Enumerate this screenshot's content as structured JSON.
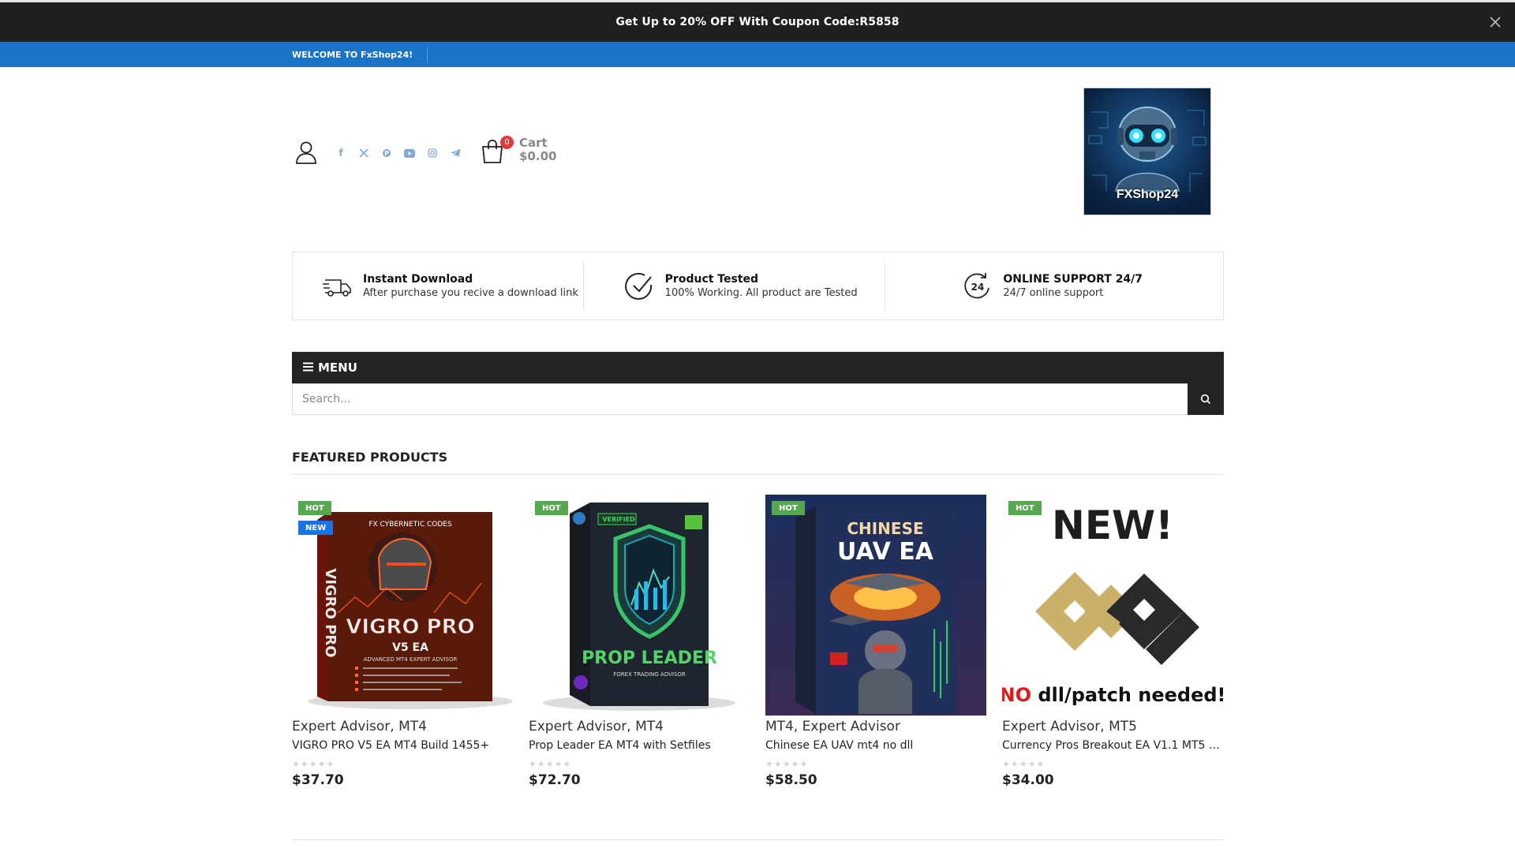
{
  "promo": {
    "prefix": "Get Up to ",
    "discount": "20% OFF",
    "middle": " With Coupon Code:",
    "code": "R5858"
  },
  "welcome": {
    "text": "WELCOME TO FxShop24!"
  },
  "social_icons": [
    "facebook-icon",
    "x-twitter-icon",
    "pinterest-icon",
    "youtube-icon",
    "instagram-icon",
    "telegram-icon"
  ],
  "cart": {
    "count": "0",
    "label": "Cart",
    "total": "$0.00"
  },
  "logo": {
    "text": "FXShop24"
  },
  "features": [
    {
      "icon": "truck-icon",
      "title": "Instant Download",
      "subtitle": "After purchase you recive a download link"
    },
    {
      "icon": "check-circle-icon",
      "title": "Product Tested",
      "subtitle": "100% Working. All product are Tested"
    },
    {
      "icon": "support-24-icon",
      "title": "ONLINE SUPPORT 24/7",
      "subtitle": "24/7 online support",
      "icon_text": "24"
    }
  ],
  "menu": {
    "label": "MENU"
  },
  "search": {
    "placeholder": "Search..."
  },
  "section": {
    "title": "FEATURED PRODUCTS"
  },
  "products": [
    {
      "badges": [
        "HOT",
        "NEW"
      ],
      "category": "Expert Advisor, MT4",
      "name": "VIGRO PRO V5 EA MT4 Build 1455+",
      "price": "$37.70",
      "rating": 0,
      "image": {
        "title": "VIGRO PRO",
        "subtitle": "V5 EA",
        "spine": "VIGRO PRO",
        "top": "FX CYBERNETIC CODES",
        "tagline": "ADVANCED MT4 EXPERT ADVISOR"
      }
    },
    {
      "badges": [
        "HOT"
      ],
      "category": "Expert Advisor, MT4",
      "name": "Prop Leader EA MT4 with Setfiles",
      "price": "$72.70",
      "rating": 0,
      "image": {
        "title": "PROP LEADER",
        "subtitle": "FOREX TRADING ADVISOR",
        "top": "VERIFIED"
      }
    },
    {
      "badges": [
        "HOT"
      ],
      "category": "MT4, Expert Advisor",
      "name": "Chinese EA UAV mt4 no dll",
      "price": "$58.50",
      "rating": 0,
      "image": {
        "title": "CHINESE",
        "subtitle": "UAV EA"
      }
    },
    {
      "badges": [
        "HOT"
      ],
      "category": "Expert Advisor, MT5",
      "name": "Currency Pros Breakout EA V1.1 MT5 N...",
      "price": "$34.00",
      "rating": 0,
      "image": {
        "title": "NEW!",
        "note_strong": "NO",
        "note": " dll/patch needed!"
      }
    }
  ],
  "colors": {
    "promo_bg": "#1f1f1f",
    "welcome_bg": "#1a73c4",
    "menu_bg": "#232323",
    "hot_badge": "#55a84e",
    "new_badge": "#1a73e0",
    "cart_badge": "#e03a3a",
    "social": "#7ea9d8"
  }
}
